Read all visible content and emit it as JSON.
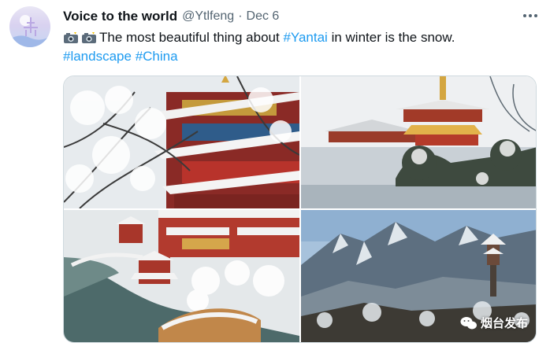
{
  "tweet": {
    "author_name": "Voice to the world",
    "handle": "@Ytlfeng",
    "separator": "·",
    "date": "Dec 6",
    "text_main": "The most beautiful thing about ",
    "hashtag_yantai": "#Yantai",
    "text_tail": " in winter is the snow.",
    "hashtag_landscape": "#landscape",
    "hashtag_china": "#China",
    "emoji_icons": [
      "camera-with-flash-icon",
      "camera-with-flash-icon"
    ]
  },
  "media": {
    "watermark_text": "烟台发布",
    "photos": [
      {
        "name": "snowy-pagoda-tree-photo"
      },
      {
        "name": "palace-over-lake-photo"
      },
      {
        "name": "aerial-garden-photo"
      },
      {
        "name": "mountain-pavilion-photo"
      }
    ]
  },
  "colors": {
    "link": "#1d9bf0",
    "text": "#0f1419",
    "secondary": "#536471"
  }
}
